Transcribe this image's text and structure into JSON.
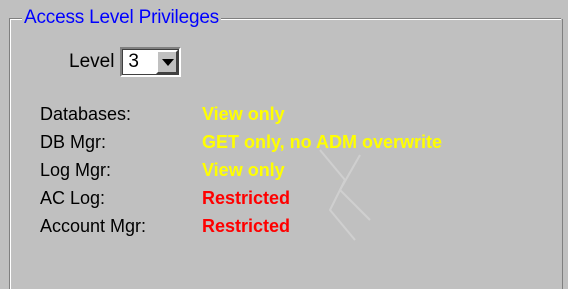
{
  "groupbox": {
    "title": "Access Level Privileges"
  },
  "level": {
    "label": "Level",
    "selected": "3"
  },
  "privileges": [
    {
      "label": "Databases:",
      "value": "View only",
      "color": "#ffff00"
    },
    {
      "label": "DB Mgr:",
      "value": "GET only, no ADM overwrite",
      "color": "#ffff00"
    },
    {
      "label": "Log Mgr:",
      "value": "View only",
      "color": "#ffff00"
    },
    {
      "label": "AC Log:",
      "value": "Restricted",
      "color": "#ff0000"
    },
    {
      "label": "Account Mgr:",
      "value": "Restricted",
      "color": "#ff0000"
    }
  ],
  "colors": {
    "background": "#c0c0c0",
    "title": "#0000ff",
    "allowed": "#ffff00",
    "restricted": "#ff0000"
  }
}
